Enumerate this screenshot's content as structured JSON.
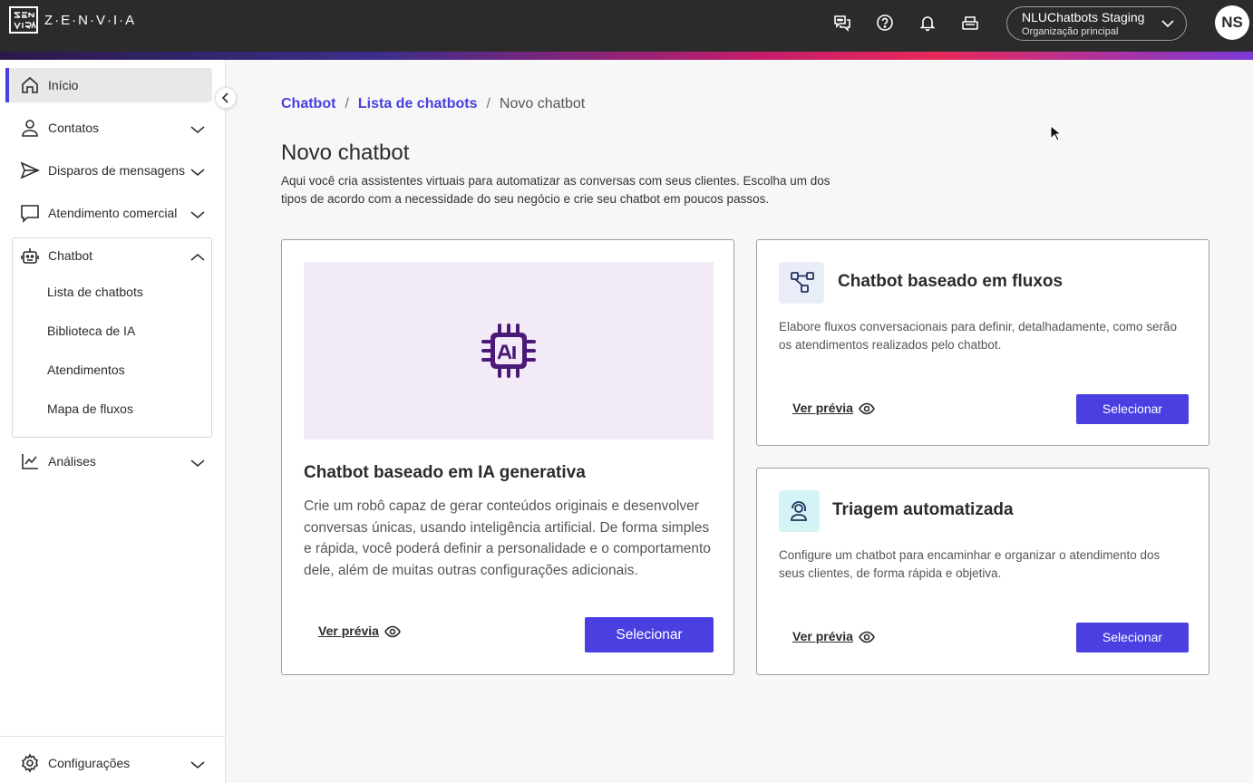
{
  "app": {
    "logo_text": "Z·E·N·V·I·A"
  },
  "header": {
    "org_name": "NLUChatbots Staging",
    "org_sub": "Organização principal",
    "avatar_initials": "NS",
    "icons": [
      "chat-icon",
      "help-icon",
      "bell-icon",
      "inbox-icon"
    ]
  },
  "sidebar": {
    "items": [
      {
        "label": "Início",
        "icon": "home-icon"
      },
      {
        "label": "Contatos",
        "icon": "person-icon"
      },
      {
        "label": "Disparos de mensagens",
        "icon": "send-icon"
      },
      {
        "label": "Atendimento comercial",
        "icon": "chat-bubble-icon"
      },
      {
        "label": "Chatbot",
        "icon": "robot-icon"
      },
      {
        "label": "Análises",
        "icon": "chart-icon"
      },
      {
        "label": "Configurações",
        "icon": "gear-icon"
      }
    ],
    "chatbot_subitems": [
      "Lista de chatbots",
      "Biblioteca de IA",
      "Atendimentos",
      "Mapa de fluxos"
    ]
  },
  "breadcrumb": {
    "level1": "Chatbot",
    "level2": "Lista de chatbots",
    "current": "Novo chatbot",
    "separator": "/"
  },
  "page": {
    "title": "Novo chatbot",
    "description": "Aqui você cria assistentes virtuais para automatizar as conversas com seus clientes. Escolha um dos tipos de acordo com a necessidade do seu negócio e crie seu chatbot em poucos passos."
  },
  "cards": {
    "ai": {
      "title": "Chatbot baseado em IA generativa",
      "description": "Crie um robô capaz de gerar conteúdos originais e desenvolver conversas únicas, usando inteligência artificial. De forma simples e rápida, você poderá definir a personalidade e o comportamento dele, além de muitas outras configurações adicionais.",
      "preview_label": "Ver prévia",
      "select_label": "Selecionar"
    },
    "flows": {
      "title": "Chatbot baseado em fluxos",
      "description": "Elabore fluxos conversacionais para definir, detalhadamente, como serão os atendimentos realizados pelo chatbot.",
      "preview_label": "Ver prévia",
      "select_label": "Selecionar"
    },
    "triage": {
      "title": "Triagem automatizada",
      "description": "Configure um chatbot para encaminhar e organizar o atendimento dos seus clientes, de forma rápida e objetiva.",
      "preview_label": "Ver prévia",
      "select_label": "Selecionar"
    }
  },
  "colors": {
    "primary": "#4a3fe0",
    "hero_bg": "#f2ebf7",
    "ai_icon": "#4b1a78",
    "flows_tile": "#e9edf8",
    "triage_tile": "#d3f3f6"
  }
}
